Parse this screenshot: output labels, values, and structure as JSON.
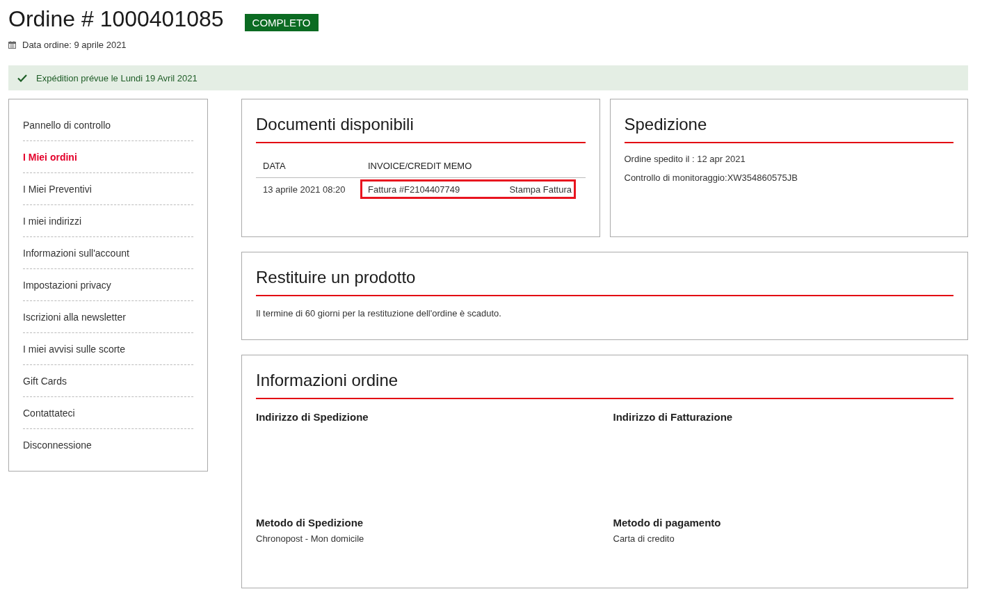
{
  "order": {
    "title": "Ordine # 1000401085",
    "status": "COMPLETO",
    "date": "Data ordine: 9 aprile 2021"
  },
  "notice": {
    "text": "Expédition prévue le Lundi 19 Avril 2021"
  },
  "sidebar": {
    "items": [
      {
        "label": "Pannello di controllo",
        "selected": false
      },
      {
        "label": "I Miei ordini",
        "selected": true
      },
      {
        "label": "I Miei Preventivi",
        "selected": false
      },
      {
        "label": "I miei indirizzi",
        "selected": false
      },
      {
        "label": "Informazioni sull'account",
        "selected": false
      },
      {
        "label": "Impostazioni privacy",
        "selected": false
      },
      {
        "label": "Iscrizioni alla newsletter",
        "selected": false
      },
      {
        "label": "I miei avvisi sulle scorte",
        "selected": false
      },
      {
        "label": "Gift Cards",
        "selected": false
      },
      {
        "label": "Contattateci",
        "selected": false
      },
      {
        "label": "Disconnessione",
        "selected": false
      }
    ]
  },
  "documents": {
    "title": "Documenti disponibili",
    "columns": [
      "DATA",
      "INVOICE/CREDIT MEMO"
    ],
    "rows": [
      {
        "date": "13 aprile 2021 08:20",
        "invoice": "Fattura #F2104407749",
        "action": "Stampa Fattura",
        "highlighted": true
      }
    ]
  },
  "shipment": {
    "title": "Spedizione",
    "lines": [
      "Ordine spedito il : 12 apr 2021",
      "Controllo di monitoraggio:XW354860575JB"
    ]
  },
  "returns": {
    "title": "Restituire un prodotto",
    "text": "Il termine di 60 giorni per la restituzione dell'ordine è scaduto."
  },
  "order_info": {
    "title": "Informazioni ordine",
    "sections": [
      {
        "heading": "Indirizzo di Spedizione"
      },
      {
        "heading": "Indirizzo di Fatturazione"
      },
      {
        "heading": "Metodo di Spedizione",
        "value": "Chronopost - Mon domicile"
      },
      {
        "heading": "Metodo di pagamento",
        "value": "Carta di credito"
      }
    ]
  }
}
